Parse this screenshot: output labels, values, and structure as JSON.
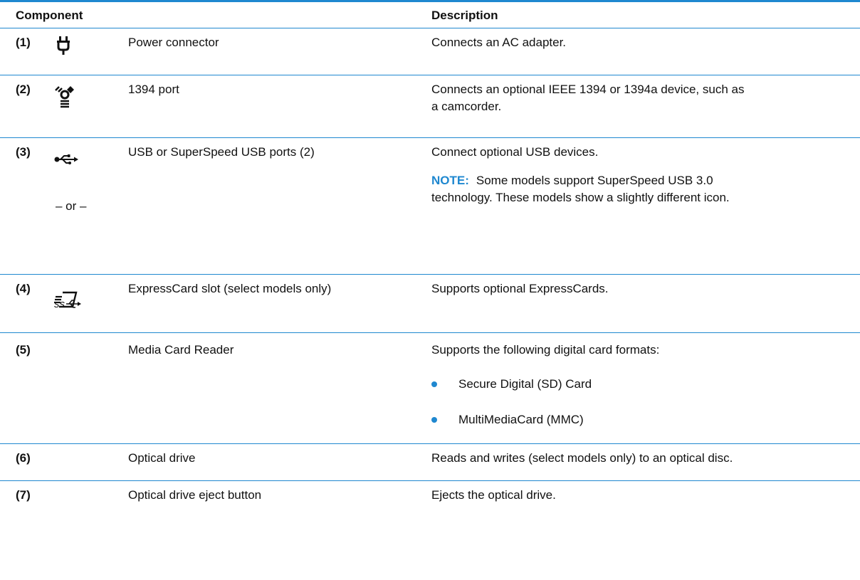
{
  "table": {
    "headers": {
      "component": "Component",
      "description": "Description"
    },
    "rows": [
      {
        "num": "(1)",
        "name": "Power connector",
        "description": "Connects an AC adapter."
      },
      {
        "num": "(2)",
        "name": "1394 port",
        "description_line1": "Connects an optional IEEE 1394 or 1394a device, such as",
        "description_line2": "a camcorder."
      },
      {
        "num": "(3)",
        "name": "USB or SuperSpeed USB ports (2)",
        "description": "Connect optional USB devices.",
        "or_text": "– or –",
        "note_label": "NOTE:",
        "note_line1": "Some models support SuperSpeed USB 3.0",
        "note_line2": "technology. These models show a slightly different icon."
      },
      {
        "num": "(4)",
        "name": "ExpressCard slot (select models only)",
        "description": "Supports optional ExpressCards."
      },
      {
        "num": "(5)",
        "name": "Media Card Reader",
        "description": "Supports the following digital card formats:",
        "bullets": [
          "Secure Digital (SD) Card",
          "MultiMediaCard (MMC)"
        ]
      },
      {
        "num": "(6)",
        "name": "Optical drive",
        "description": "Reads and writes (select models only) to an optical disc."
      },
      {
        "num": "(7)",
        "name": "Optical drive eject button",
        "description": "Ejects the optical drive."
      }
    ]
  },
  "colors": {
    "accent": "#1f88d0",
    "text": "#111111"
  },
  "icons": [
    "power-plug-icon",
    "firewire-icon",
    "usb-icon",
    "superspeed-usb-icon",
    "expresscard-icon"
  ]
}
